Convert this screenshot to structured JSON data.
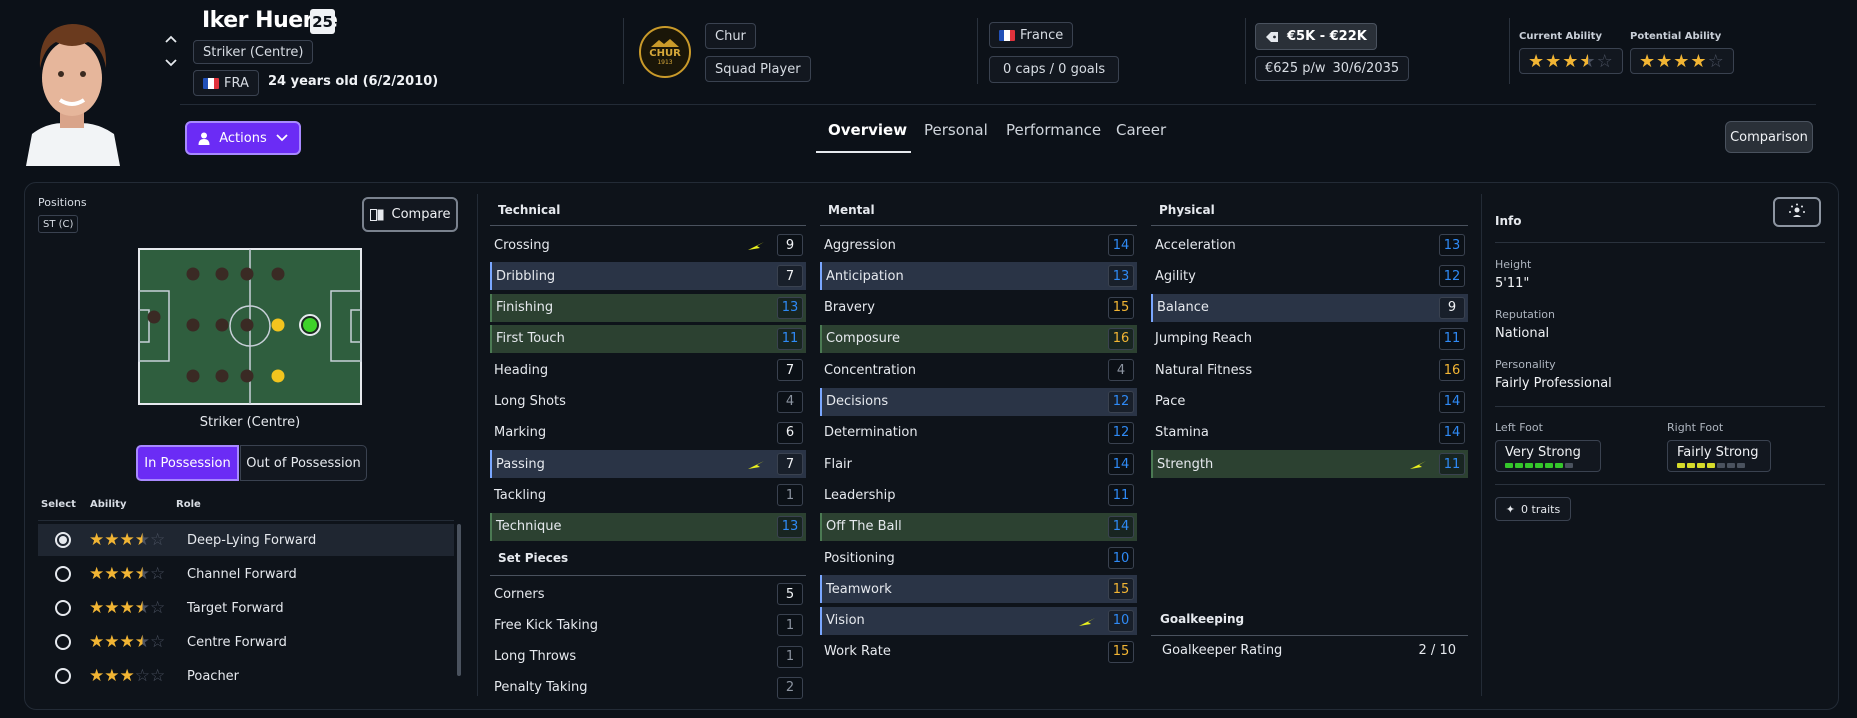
{
  "header": {
    "player_name": "Iker Huerte",
    "number": "25",
    "position": "Striker (Centre)",
    "nationality_code": "FRA",
    "age_dob": "24 years old (6/2/2010)",
    "club_name": "Chur",
    "club_badge_text": "CHUR",
    "club_badge_year": "1913",
    "squad_status": "Squad Player",
    "country": "France",
    "caps_goals": "0 caps / 0 goals",
    "value": "€5K - €22K",
    "wage": "€625 p/w",
    "contract_end": "30/6/2035",
    "current_ability_label": "Current Ability",
    "potential_ability_label": "Potential Ability",
    "current_ability_stars": 3.5,
    "potential_ability_stars": 4
  },
  "actions_label": "Actions",
  "tabs": [
    "Overview",
    "Personal",
    "Performance",
    "Career"
  ],
  "comparison_label": "Comparison",
  "positions": {
    "label": "Positions",
    "badge": "ST (C)",
    "compare_label": "Compare",
    "pitch_caption": "Striker (Centre)",
    "in_possession": "In Possession",
    "out_of_possession": "Out of Possession"
  },
  "roles": {
    "headers": [
      "Select",
      "Ability",
      "Role"
    ],
    "items": [
      {
        "name": "Deep-Lying Forward",
        "stars": 3.5,
        "selected": true
      },
      {
        "name": "Channel Forward",
        "stars": 3.5,
        "selected": false
      },
      {
        "name": "Target Forward",
        "stars": 3.5,
        "selected": false
      },
      {
        "name": "Centre Forward",
        "stars": 3.5,
        "selected": false
      },
      {
        "name": "Poacher",
        "stars": 3,
        "selected": false
      }
    ]
  },
  "technical": {
    "title": "Technical",
    "items": [
      {
        "name": "Crossing",
        "value": "9",
        "color": "white",
        "hl": "",
        "arrow": true
      },
      {
        "name": "Dribbling",
        "value": "7",
        "color": "white",
        "hl": "blue",
        "arrow": false
      },
      {
        "name": "Finishing",
        "value": "13",
        "color": "blue",
        "hl": "green",
        "arrow": false
      },
      {
        "name": "First Touch",
        "value": "11",
        "color": "blue",
        "hl": "green",
        "arrow": false
      },
      {
        "name": "Heading",
        "value": "7",
        "color": "white",
        "hl": "",
        "arrow": false
      },
      {
        "name": "Long Shots",
        "value": "4",
        "color": "gray",
        "hl": "",
        "arrow": false
      },
      {
        "name": "Marking",
        "value": "6",
        "color": "white",
        "hl": "",
        "arrow": false
      },
      {
        "name": "Passing",
        "value": "7",
        "color": "white",
        "hl": "blue",
        "arrow": true
      },
      {
        "name": "Tackling",
        "value": "1",
        "color": "gray",
        "hl": "",
        "arrow": false
      },
      {
        "name": "Technique",
        "value": "13",
        "color": "blue",
        "hl": "green",
        "arrow": false
      }
    ]
  },
  "set_pieces": {
    "title": "Set Pieces",
    "items": [
      {
        "name": "Corners",
        "value": "5",
        "color": "white",
        "hl": "",
        "arrow": false
      },
      {
        "name": "Free Kick Taking",
        "value": "1",
        "color": "gray",
        "hl": "",
        "arrow": false
      },
      {
        "name": "Long Throws",
        "value": "1",
        "color": "gray",
        "hl": "",
        "arrow": false
      },
      {
        "name": "Penalty Taking",
        "value": "2",
        "color": "gray",
        "hl": "",
        "arrow": false
      }
    ]
  },
  "mental": {
    "title": "Mental",
    "items": [
      {
        "name": "Aggression",
        "value": "14",
        "color": "blue",
        "hl": "",
        "arrow": false
      },
      {
        "name": "Anticipation",
        "value": "13",
        "color": "blue",
        "hl": "blue",
        "arrow": false
      },
      {
        "name": "Bravery",
        "value": "15",
        "color": "orange",
        "hl": "",
        "arrow": false
      },
      {
        "name": "Composure",
        "value": "16",
        "color": "orange",
        "hl": "green",
        "arrow": false
      },
      {
        "name": "Concentration",
        "value": "4",
        "color": "gray",
        "hl": "",
        "arrow": false
      },
      {
        "name": "Decisions",
        "value": "12",
        "color": "blue",
        "hl": "blue",
        "arrow": false
      },
      {
        "name": "Determination",
        "value": "12",
        "color": "blue",
        "hl": "",
        "arrow": false
      },
      {
        "name": "Flair",
        "value": "14",
        "color": "blue",
        "hl": "",
        "arrow": false
      },
      {
        "name": "Leadership",
        "value": "11",
        "color": "blue",
        "hl": "",
        "arrow": false
      },
      {
        "name": "Off The Ball",
        "value": "14",
        "color": "blue",
        "hl": "green",
        "arrow": false
      },
      {
        "name": "Positioning",
        "value": "10",
        "color": "blue",
        "hl": "",
        "arrow": false
      },
      {
        "name": "Teamwork",
        "value": "15",
        "color": "orange",
        "hl": "blue",
        "arrow": false
      },
      {
        "name": "Vision",
        "value": "10",
        "color": "blue",
        "hl": "blue",
        "arrow": true
      },
      {
        "name": "Work Rate",
        "value": "15",
        "color": "orange",
        "hl": "",
        "arrow": false
      }
    ]
  },
  "physical": {
    "title": "Physical",
    "items": [
      {
        "name": "Acceleration",
        "value": "13",
        "color": "blue",
        "hl": "",
        "arrow": false
      },
      {
        "name": "Agility",
        "value": "12",
        "color": "blue",
        "hl": "",
        "arrow": false
      },
      {
        "name": "Balance",
        "value": "9",
        "color": "white",
        "hl": "blue",
        "arrow": false
      },
      {
        "name": "Jumping Reach",
        "value": "11",
        "color": "blue",
        "hl": "",
        "arrow": false
      },
      {
        "name": "Natural Fitness",
        "value": "16",
        "color": "orange",
        "hl": "",
        "arrow": false
      },
      {
        "name": "Pace",
        "value": "14",
        "color": "blue",
        "hl": "",
        "arrow": false
      },
      {
        "name": "Stamina",
        "value": "14",
        "color": "blue",
        "hl": "",
        "arrow": false
      },
      {
        "name": "Strength",
        "value": "11",
        "color": "blue",
        "hl": "green",
        "arrow": true
      }
    ]
  },
  "goalkeeping": {
    "title": "Goalkeeping",
    "label": "Goalkeeper Rating",
    "value": "2 / 10"
  },
  "info": {
    "title": "Info",
    "height_label": "Height",
    "height": "5'11\"",
    "reputation_label": "Reputation",
    "reputation": "National",
    "personality_label": "Personality",
    "personality": "Fairly Professional",
    "left_foot_label": "Left Foot",
    "left_foot": "Very Strong",
    "left_foot_level": 6,
    "right_foot_label": "Right Foot",
    "right_foot": "Fairly Strong",
    "right_foot_level": 4,
    "foot_max": 7,
    "traits": "0 traits"
  },
  "colors": {
    "accent": "#6b2cf5",
    "blue": "#2f8af5",
    "orange": "#f2b534",
    "star": "#f2b534",
    "foot_green": "#35c72b",
    "foot_yellow": "#d6db2a"
  }
}
